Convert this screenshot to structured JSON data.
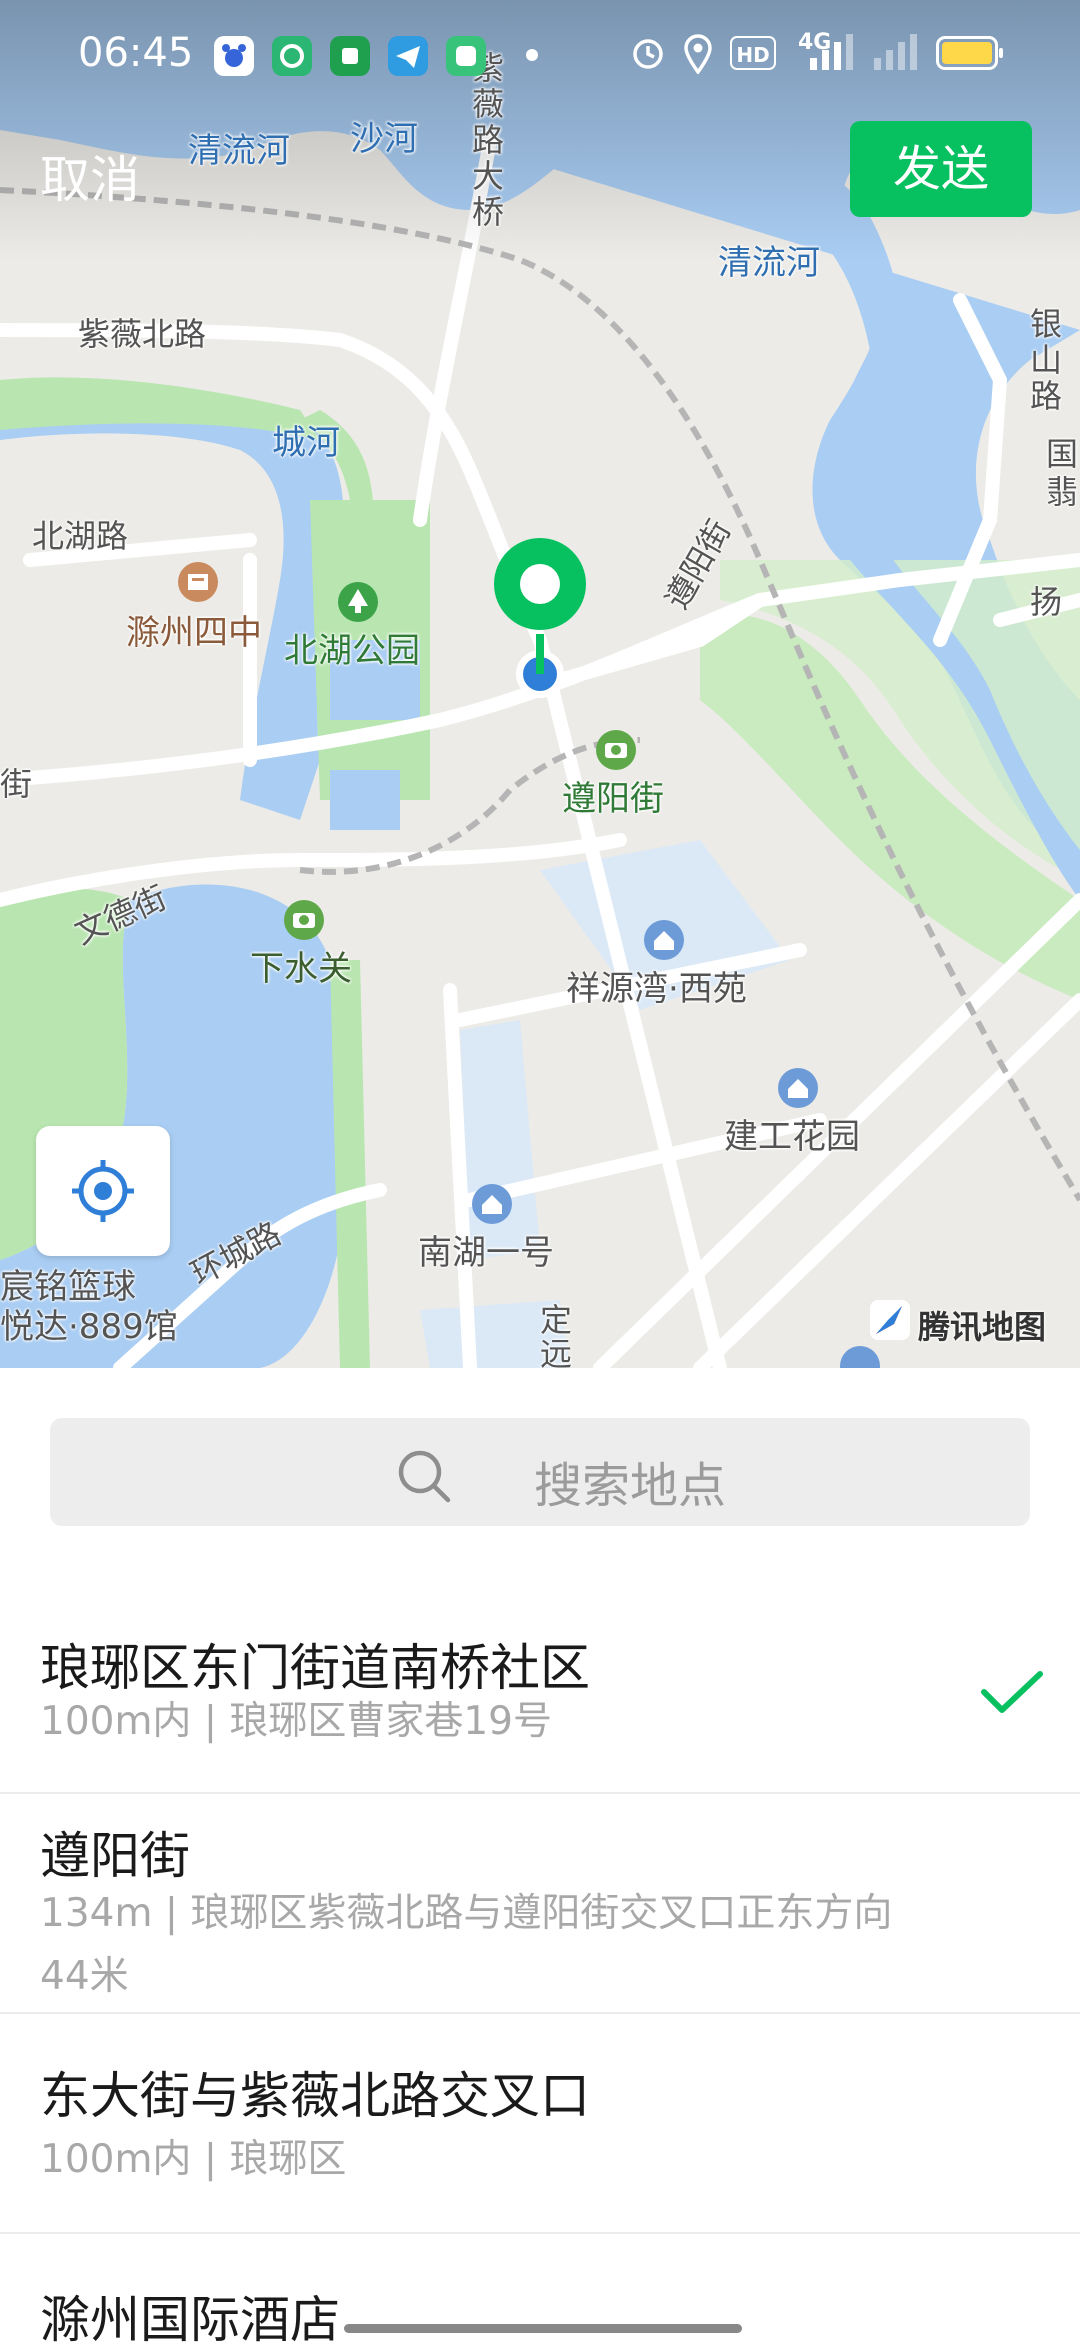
{
  "status_bar": {
    "time": "06:45",
    "hd": "HD",
    "network": "4G"
  },
  "header": {
    "cancel_label": "取消",
    "send_label": "发送"
  },
  "map": {
    "provider": "腾讯地图",
    "labels": {
      "qingliuhe_1": "清流河",
      "shahe": "沙河",
      "ziwei_bridge": "紫薇路大桥",
      "qingliuhe_2": "清流河",
      "ziwei_north_road": "紫薇北路",
      "yinshan_road": "银山路",
      "guo": "国",
      "fei": "翡",
      "chenghe": "城河",
      "beihu_road": "北湖路",
      "chuzhou_no4": "滁州四中",
      "beihu_park": "北湖公园",
      "zunyang_road_vertical": "遵阳街",
      "yang": "扬",
      "zunyang_street": "遵阳街",
      "jie": "街",
      "wende_street": "文德街",
      "xiashuiguan": "下水关",
      "xiangyuanwan": "祥源湾·西苑",
      "jiangong_garden": "建工花园",
      "nanhu_no1": "南湖一号",
      "huancheng_road": "环城路",
      "basketball_1": "宸铭篮球",
      "basketball_2": "悦达·889馆",
      "ding": "定",
      "yuan": "远"
    }
  },
  "search": {
    "placeholder": "搜索地点"
  },
  "results": [
    {
      "title": "琅琊区东门街道南桥社区",
      "sub": "100m内 | 琅琊区曹家巷19号",
      "selected": true
    },
    {
      "title": "遵阳街",
      "sub": "134m | 琅琊区紫薇北路与遵阳街交叉口正东方向44米",
      "selected": false
    },
    {
      "title": "东大街与紫薇北路交叉口",
      "sub": "100m内 | 琅琊区",
      "selected": false
    },
    {
      "title": "滁州国际酒店",
      "sub": "",
      "selected": false
    }
  ],
  "colors": {
    "accent": "#07c160",
    "water": "#a9cdf3",
    "park": "#b9e6b0",
    "location_dot": "#2f7fd8"
  }
}
